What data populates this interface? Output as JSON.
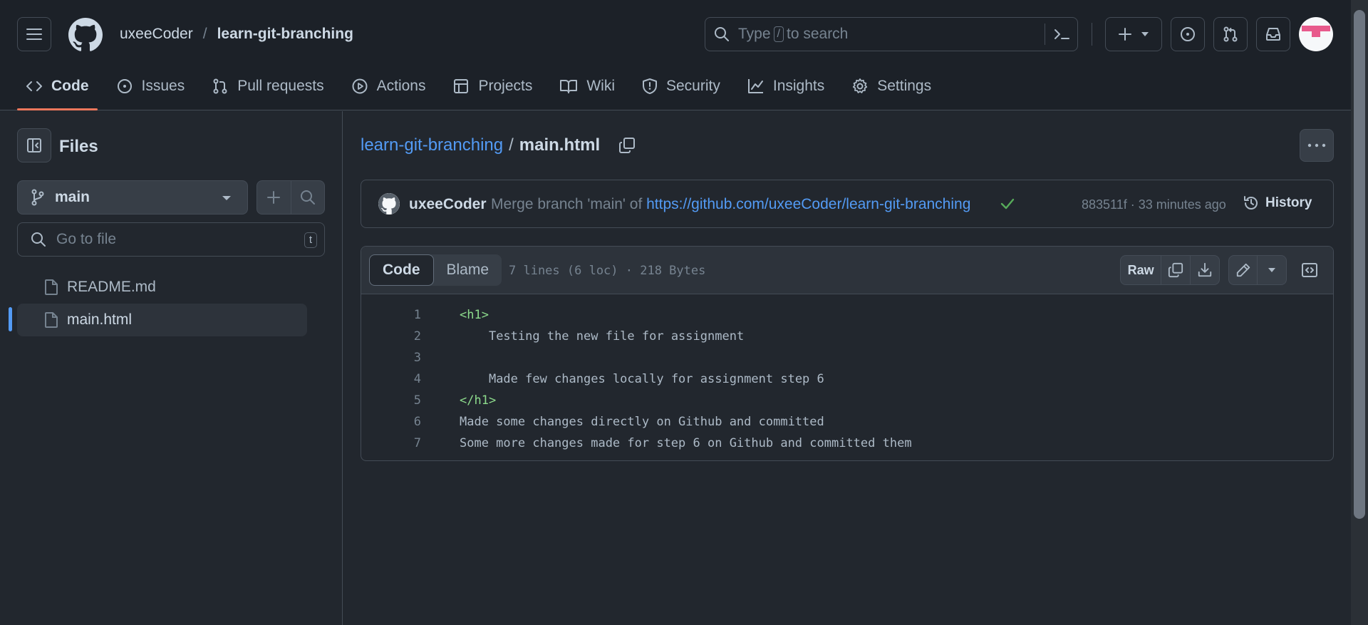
{
  "header": {
    "owner": "uxeeCoder",
    "separator": "/",
    "repo": "learn-git-branching",
    "search_prefix": "Type",
    "search_key": "/",
    "search_suffix": "to search"
  },
  "tabs": [
    {
      "label": "Code",
      "icon": "code-icon"
    },
    {
      "label": "Issues",
      "icon": "issue-opened-icon"
    },
    {
      "label": "Pull requests",
      "icon": "git-pull-request-icon"
    },
    {
      "label": "Actions",
      "icon": "play-icon"
    },
    {
      "label": "Projects",
      "icon": "table-icon"
    },
    {
      "label": "Wiki",
      "icon": "book-icon"
    },
    {
      "label": "Security",
      "icon": "shield-icon"
    },
    {
      "label": "Insights",
      "icon": "graph-icon"
    },
    {
      "label": "Settings",
      "icon": "gear-icon"
    }
  ],
  "sidebar": {
    "title": "Files",
    "branch": "main",
    "goto_placeholder": "Go to file",
    "goto_shortcut": "t",
    "files": [
      "README.md",
      "main.html"
    ],
    "selected_file": "main.html"
  },
  "breadcrumb": {
    "repo": "learn-git-branching",
    "sep": "/",
    "file": "main.html"
  },
  "commit": {
    "author": "uxeeCoder",
    "message": "Merge branch 'main' of ",
    "link": "https://github.com/uxeeCoder/learn-git-branching",
    "sha_time": "883511f · 33 minutes ago",
    "history_label": "History"
  },
  "code_view": {
    "tab_code": "Code",
    "tab_blame": "Blame",
    "info": "7 lines (6 loc) · 218 Bytes",
    "raw_label": "Raw"
  },
  "lines": [
    {
      "n": "1",
      "pre": "",
      "tag": "<h1>",
      "text": ""
    },
    {
      "n": "2",
      "pre": "    ",
      "tag": "",
      "text": "Testing the new file for assignment"
    },
    {
      "n": "3",
      "pre": "",
      "tag": "",
      "text": ""
    },
    {
      "n": "4",
      "pre": "    ",
      "tag": "",
      "text": "Made few changes locally for assignment step 6"
    },
    {
      "n": "5",
      "pre": "",
      "tag": "</h1>",
      "text": ""
    },
    {
      "n": "6",
      "pre": "",
      "tag": "",
      "text": "Made some changes directly on Github and committed"
    },
    {
      "n": "7",
      "pre": "",
      "tag": "",
      "text": "Some more changes made for step 6 on Github and committed them"
    }
  ],
  "colors": {
    "accent": "#539bf5",
    "tab_underline": "#ec775c",
    "success": "#57ab5a",
    "tag_green": "#8ddb8c",
    "avatar_pink": "#e85a8c"
  }
}
